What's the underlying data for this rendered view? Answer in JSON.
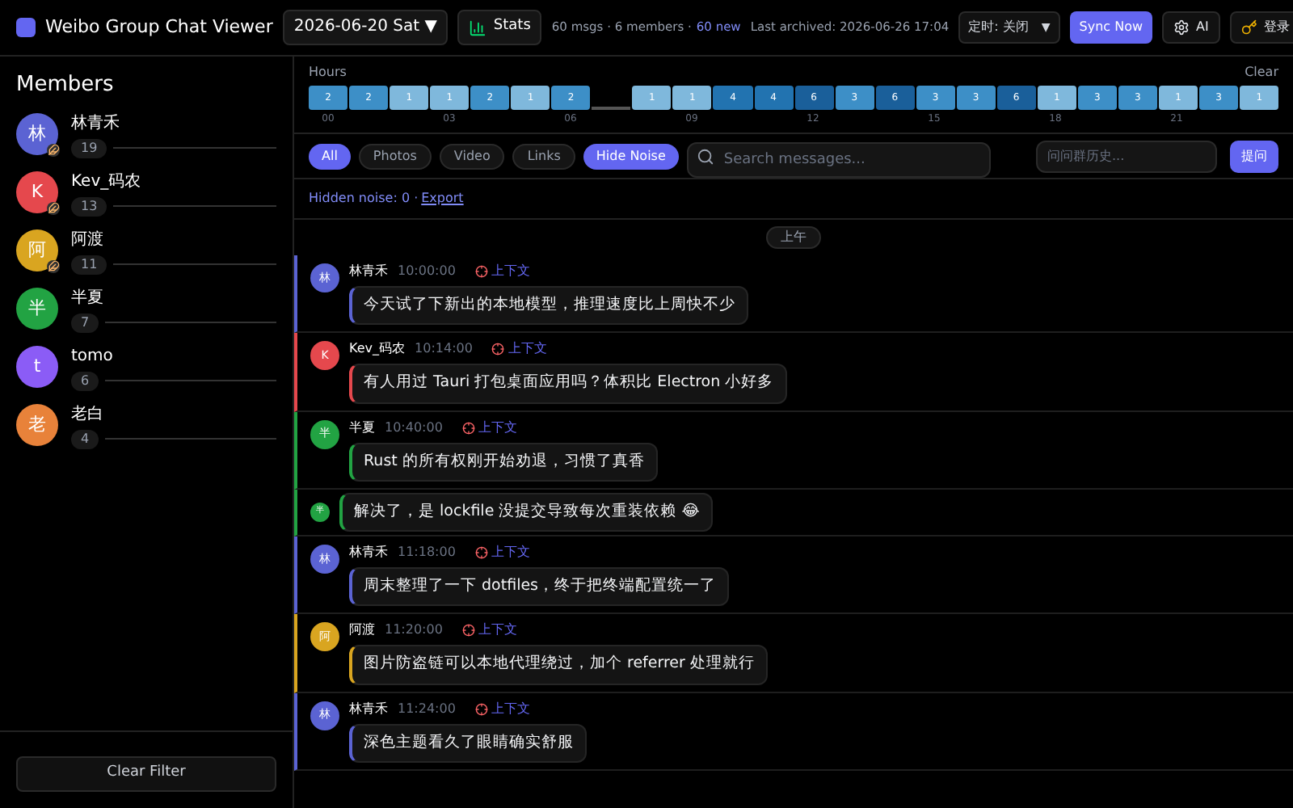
{
  "header": {
    "title": "Weibo Group Chat Viewer",
    "date": "2026-06-20 Sat ▼",
    "stats": "Stats",
    "summary": "60 msgs · 6 members ·",
    "new_count": "60 new",
    "archived": "Last archived: 2026-06-26 17:04",
    "timer": "定时: 关闭",
    "timer_caret": "▼",
    "sync": "Sync Now",
    "ai": "AI",
    "login": "登录"
  },
  "sidebar": {
    "title": "Members",
    "clear": "Clear Filter",
    "members": [
      {
        "initial": "林",
        "name": "林青禾",
        "count": "19",
        "color": "#5b63d3",
        "badge": true
      },
      {
        "initial": "K",
        "name": "Kev_码农",
        "count": "13",
        "color": "#e5484d",
        "badge": true
      },
      {
        "initial": "阿",
        "name": "阿渡",
        "count": "11",
        "color": "#d9a520",
        "badge": true
      },
      {
        "initial": "半",
        "name": "半夏",
        "count": "7",
        "color": "#22a343",
        "badge": false
      },
      {
        "initial": "t",
        "name": "tomo",
        "count": "6",
        "color": "#8b5cf6",
        "badge": false
      },
      {
        "initial": "老",
        "name": "老白",
        "count": "4",
        "color": "#e8823a",
        "badge": false
      }
    ]
  },
  "hours": {
    "title": "Hours",
    "clear": "Clear",
    "cells": [
      {
        "kind": "bar",
        "count": "2",
        "color": "#3d8fc7"
      },
      {
        "kind": "bar",
        "count": "2",
        "color": "#3d8fc7"
      },
      {
        "kind": "bar",
        "count": "1",
        "color": "#7fb8dc"
      },
      {
        "kind": "bar",
        "count": "1",
        "color": "#7fb8dc"
      },
      {
        "kind": "bar",
        "count": "2",
        "color": "#3d8fc7"
      },
      {
        "kind": "bar",
        "count": "1",
        "color": "#7fb8dc"
      },
      {
        "kind": "bar",
        "count": "2",
        "color": "#3d8fc7"
      },
      {
        "kind": "empty"
      },
      {
        "kind": "bar",
        "count": "1",
        "color": "#7fb8dc"
      },
      {
        "kind": "bar",
        "count": "1",
        "color": "#7fb8dc"
      },
      {
        "kind": "bar",
        "count": "4",
        "color": "#2273b0"
      },
      {
        "kind": "bar",
        "count": "4",
        "color": "#2273b0"
      },
      {
        "kind": "bar",
        "count": "6",
        "color": "#1a5f9a"
      },
      {
        "kind": "bar",
        "count": "3",
        "color": "#3d8fc7"
      },
      {
        "kind": "bar",
        "count": "6",
        "color": "#1a5f9a"
      },
      {
        "kind": "bar",
        "count": "3",
        "color": "#3d8fc7"
      },
      {
        "kind": "bar",
        "count": "3",
        "color": "#3d8fc7"
      },
      {
        "kind": "bar",
        "count": "6",
        "color": "#1a5f9a"
      },
      {
        "kind": "bar",
        "count": "1",
        "color": "#7fb8dc"
      },
      {
        "kind": "bar",
        "count": "3",
        "color": "#3d8fc7"
      },
      {
        "kind": "bar",
        "count": "3",
        "color": "#3d8fc7"
      },
      {
        "kind": "bar",
        "count": "1",
        "color": "#7fb8dc"
      },
      {
        "kind": "bar",
        "count": "3",
        "color": "#3d8fc7"
      },
      {
        "kind": "bar",
        "count": "1",
        "color": "#7fb8dc"
      }
    ],
    "ticks": [
      "00",
      "03",
      "06",
      "09",
      "12",
      "15",
      "18",
      "21"
    ]
  },
  "filters": [
    {
      "label": "All",
      "selected": true
    },
    {
      "label": "Photos",
      "selected": false
    },
    {
      "label": "Video",
      "selected": false
    },
    {
      "label": "Links",
      "selected": false
    },
    {
      "label": "Hide Noise",
      "selected": true
    }
  ],
  "search": {
    "placeholder": "Search messages..."
  },
  "ask": {
    "placeholder": "问问群历史...",
    "button": "提问"
  },
  "noise": {
    "label": "Hidden noise: 0 ·",
    "export": "Export"
  },
  "divider": "上午",
  "messages": [
    {
      "kind": "full",
      "initial": "林",
      "name": "林青禾",
      "time": "10:00:00",
      "context": "上下文",
      "text": "今天试了下新出的本地模型，推理速度比上周快不少",
      "color": "#5b63d3"
    },
    {
      "kind": "full",
      "initial": "K",
      "name": "Kev_码农",
      "time": "10:14:00",
      "context": "上下文",
      "text": "有人用过 Tauri 打包桌面应用吗？体积比 Electron 小好多",
      "color": "#e5484d"
    },
    {
      "kind": "full",
      "initial": "半",
      "name": "半夏",
      "time": "10:40:00",
      "context": "上下文",
      "text": "Rust 的所有权刚开始劝退，习惯了真香",
      "color": "#22a343"
    },
    {
      "kind": "cont",
      "initial": "半",
      "text": "解决了，是 lockfile 没提交导致每次重装依赖 😂",
      "color": "#22a343"
    },
    {
      "kind": "full",
      "initial": "林",
      "name": "林青禾",
      "time": "11:18:00",
      "context": "上下文",
      "text": "周末整理了一下 dotfiles，终于把终端配置统一了",
      "color": "#5b63d3"
    },
    {
      "kind": "full",
      "initial": "阿",
      "name": "阿渡",
      "time": "11:20:00",
      "context": "上下文",
      "text": "图片防盗链可以本地代理绕过，加个 referrer 处理就行",
      "color": "#d9a520"
    },
    {
      "kind": "full",
      "initial": "林",
      "name": "林青禾",
      "time": "11:24:00",
      "context": "上下文",
      "text": "深色主题看久了眼睛确实舒服",
      "color": "#5b63d3"
    }
  ]
}
